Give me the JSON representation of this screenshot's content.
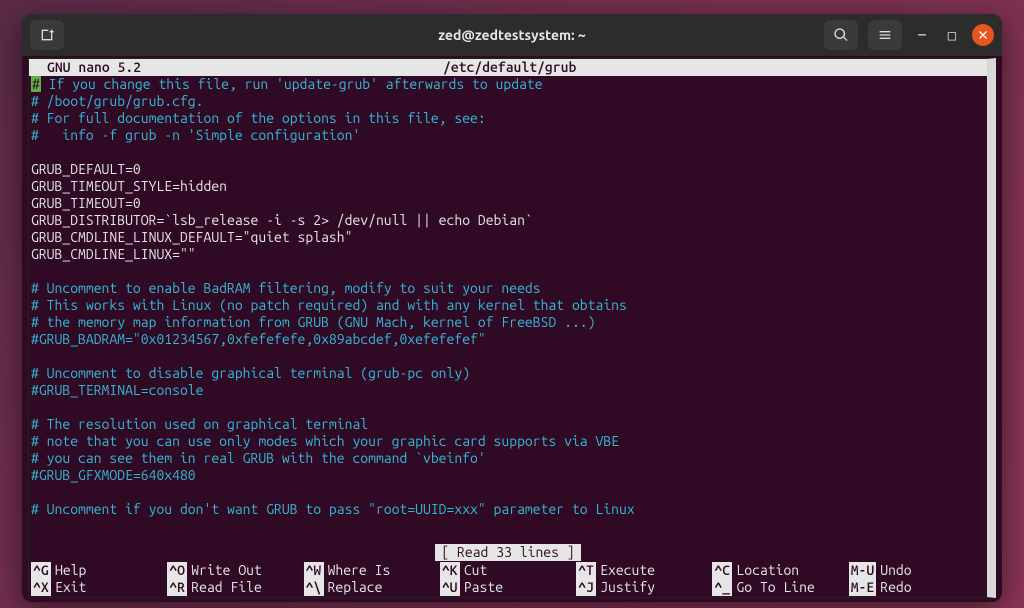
{
  "titlebar": {
    "title": "zed@zedtestsystem: ~"
  },
  "nano": {
    "app": "GNU nano 5.2",
    "file": "/etc/default/grub",
    "status": "[ Read 33 lines ]"
  },
  "lines": [
    {
      "cls": "c-comment",
      "prefix": "#",
      "text": " If you change this file, run 'update-grub' afterwards to update"
    },
    {
      "cls": "c-comment",
      "text": "# /boot/grub/grub.cfg."
    },
    {
      "cls": "c-comment",
      "text": "# For full documentation of the options in this file, see:"
    },
    {
      "cls": "c-comment",
      "text": "#   info -f grub -n 'Simple configuration'"
    },
    {
      "cls": "c-text",
      "text": ""
    },
    {
      "cls": "c-text",
      "text": "GRUB_DEFAULT=0"
    },
    {
      "cls": "c-text",
      "text": "GRUB_TIMEOUT_STYLE=hidden"
    },
    {
      "cls": "c-text",
      "text": "GRUB_TIMEOUT=0"
    },
    {
      "cls": "c-text",
      "text": "GRUB_DISTRIBUTOR=`lsb_release -i -s 2> /dev/null || echo Debian`"
    },
    {
      "cls": "c-text",
      "text": "GRUB_CMDLINE_LINUX_DEFAULT=\"quiet splash\""
    },
    {
      "cls": "c-text",
      "text": "GRUB_CMDLINE_LINUX=\"\""
    },
    {
      "cls": "c-text",
      "text": ""
    },
    {
      "cls": "c-comment",
      "text": "# Uncomment to enable BadRAM filtering, modify to suit your needs"
    },
    {
      "cls": "c-comment",
      "text": "# This works with Linux (no patch required) and with any kernel that obtains"
    },
    {
      "cls": "c-comment",
      "text": "# the memory map information from GRUB (GNU Mach, kernel of FreeBSD ...)"
    },
    {
      "cls": "c-comment",
      "text": "#GRUB_BADRAM=\"0x01234567,0xfefefefe,0x89abcdef,0xefefefef\""
    },
    {
      "cls": "c-text",
      "text": ""
    },
    {
      "cls": "c-comment",
      "text": "# Uncomment to disable graphical terminal (grub-pc only)"
    },
    {
      "cls": "c-comment",
      "text": "#GRUB_TERMINAL=console"
    },
    {
      "cls": "c-text",
      "text": ""
    },
    {
      "cls": "c-comment",
      "text": "# The resolution used on graphical terminal"
    },
    {
      "cls": "c-comment",
      "text": "# note that you can use only modes which your graphic card supports via VBE"
    },
    {
      "cls": "c-comment",
      "text": "# you can see them in real GRUB with the command `vbeinfo'"
    },
    {
      "cls": "c-comment",
      "text": "#GRUB_GFXMODE=640x480"
    },
    {
      "cls": "c-text",
      "text": ""
    },
    {
      "cls": "c-comment",
      "text": "# Uncomment if you don't want GRUB to pass \"root=UUID=xxx\" parameter to Linux"
    }
  ],
  "shortcuts": [
    {
      "key": "^G",
      "label": "Help"
    },
    {
      "key": "^O",
      "label": "Write Out"
    },
    {
      "key": "^W",
      "label": "Where Is"
    },
    {
      "key": "^K",
      "label": "Cut"
    },
    {
      "key": "^T",
      "label": "Execute"
    },
    {
      "key": "^C",
      "label": "Location"
    },
    {
      "key": "M-U",
      "label": "Undo"
    },
    {
      "key": "^X",
      "label": "Exit"
    },
    {
      "key": "^R",
      "label": "Read File"
    },
    {
      "key": "^\\",
      "label": "Replace"
    },
    {
      "key": "^U",
      "label": "Paste"
    },
    {
      "key": "^J",
      "label": "Justify"
    },
    {
      "key": "^_",
      "label": "Go To Line"
    },
    {
      "key": "M-E",
      "label": "Redo"
    }
  ]
}
